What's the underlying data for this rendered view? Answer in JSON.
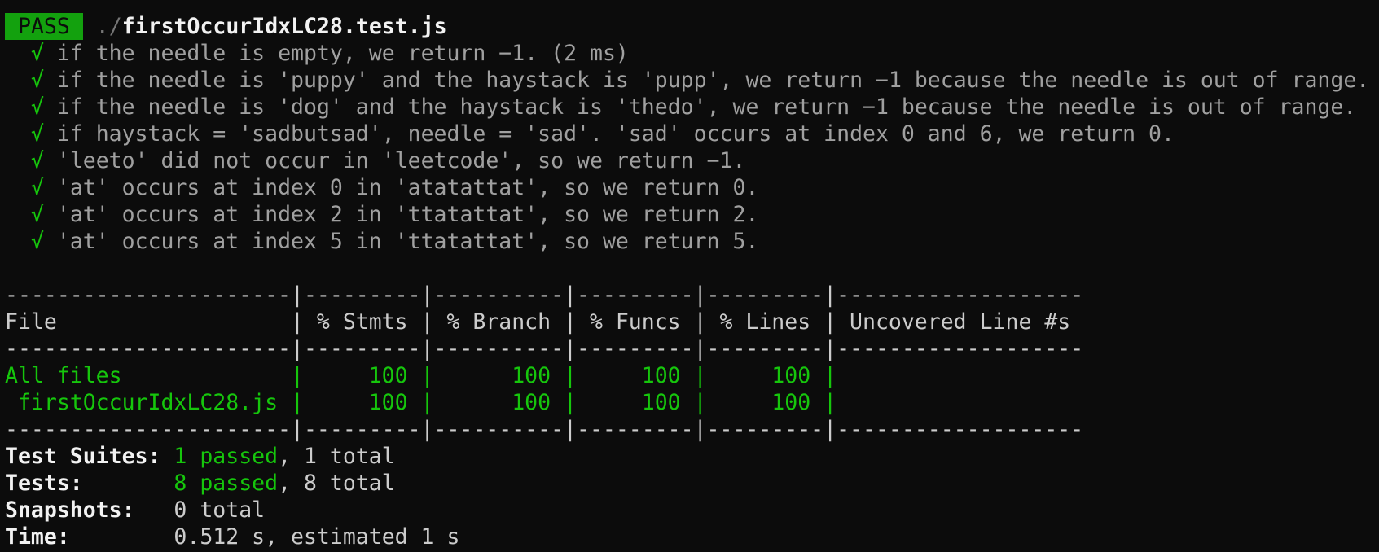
{
  "header": {
    "badge": "PASS",
    "path_prefix": "./",
    "file": "firstOccurIdxLC28.test.js"
  },
  "tests": [
    {
      "mark": "√",
      "text": "if the needle is empty, we return −1. (2 ms)"
    },
    {
      "mark": "√",
      "text": "if the needle is 'puppy' and the haystack is 'pupp', we return −1 because the needle is out of range."
    },
    {
      "mark": "√",
      "text": "if the needle is 'dog' and the haystack is 'thedo', we return −1 because the needle is out of range."
    },
    {
      "mark": "√",
      "text": "if haystack = 'sadbutsad', needle = 'sad'. 'sad' occurs at index 0 and 6, we return 0."
    },
    {
      "mark": "√",
      "text": "'leeto' did not occur in 'leetcode', so we return −1."
    },
    {
      "mark": "√",
      "text": "'at' occurs at index 0 in 'atatattat', so we return 0."
    },
    {
      "mark": "√",
      "text": "'at' occurs at index 2 in 'ttatattat', so we return 2."
    },
    {
      "mark": "√",
      "text": "'at' occurs at index 5 in 'ttatattat', so we return 5."
    }
  ],
  "coverage": {
    "separator": "----------------------|---------|----------|---------|---------|-------------------",
    "header": "File                  | % Stmts | % Branch | % Funcs | % Lines | Uncovered Line #s",
    "rows": [
      {
        "text": "All files             |     100 |      100 |     100 |     100 |"
      },
      {
        "text": " firstOccurIdxLC28.js |     100 |      100 |     100 |     100 |"
      }
    ]
  },
  "summary": {
    "suites_label": "Test Suites: ",
    "suites_passed": "1 passed",
    "suites_rest": ", 1 total",
    "tests_label": "Tests:       ",
    "tests_passed": "8 passed",
    "tests_rest": ", 8 total",
    "snapshots_label": "Snapshots:   ",
    "snapshots_value": "0 total",
    "time_label": "Time:        ",
    "time_value": "0.512 s, estimated 1 s"
  },
  "colors": {
    "background": "#0c0c0c",
    "pass_badge": "#13a10e",
    "success": "#16c60c",
    "dim_text": "#a0a0a0"
  }
}
